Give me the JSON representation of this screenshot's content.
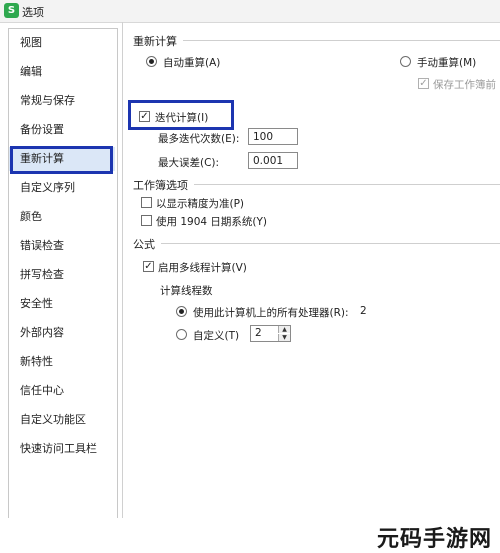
{
  "window": {
    "title": "选项",
    "icon_letter": "S"
  },
  "sidebar": {
    "items": [
      {
        "label": "视图"
      },
      {
        "label": "编辑"
      },
      {
        "label": "常规与保存"
      },
      {
        "label": "备份设置"
      },
      {
        "label": "重新计算"
      },
      {
        "label": "自定义序列"
      },
      {
        "label": "颜色"
      },
      {
        "label": "错误检查"
      },
      {
        "label": "拼写检查"
      },
      {
        "label": "安全性"
      },
      {
        "label": "外部内容"
      },
      {
        "label": "新特性"
      },
      {
        "label": "信任中心"
      },
      {
        "label": "自定义功能区"
      },
      {
        "label": "快速访问工具栏"
      }
    ],
    "selected": "重新计算"
  },
  "recalc": {
    "group_title": "重新计算",
    "auto_label": "自动重算(A)",
    "manual_label": "手动重算(M)",
    "save_before_label": "保存工作簿前",
    "iterate_label": "迭代计算(I)",
    "max_iter_label": "最多迭代次数(E):",
    "max_iter_value": "100",
    "max_change_label": "最大误差(C):",
    "max_change_value": "0.001"
  },
  "workbook": {
    "group_title": "工作簿选项",
    "precision_label": "以显示精度为准(P)",
    "date1904_label": "使用 1904 日期系统(Y)"
  },
  "formula": {
    "group_title": "公式",
    "multithread_label": "启用多线程计算(V)",
    "threads_title": "计算线程数",
    "use_all_label": "使用此计算机上的所有处理器(R):",
    "use_all_count": "2",
    "custom_label": "自定义(T)",
    "custom_value": "2"
  },
  "watermark": {
    "text": "元码手游网"
  }
}
